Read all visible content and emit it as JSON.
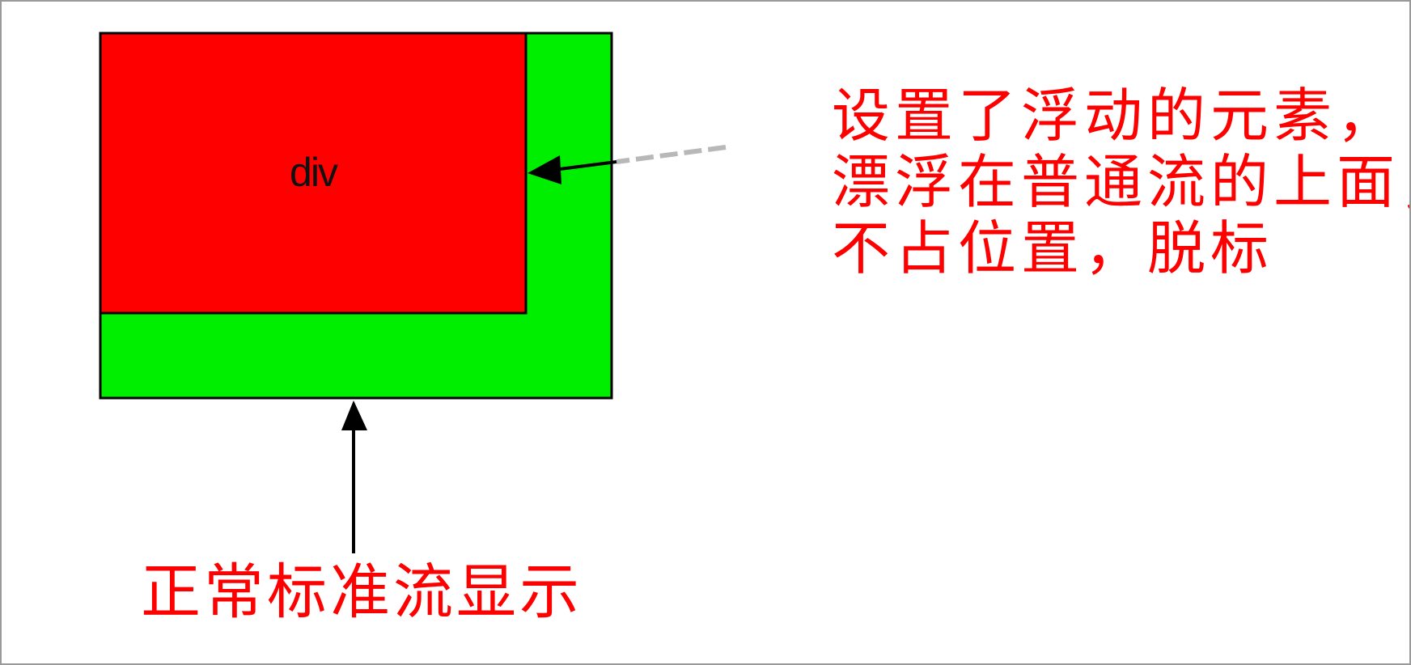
{
  "diagram": {
    "float_box_label": "div",
    "float_callout_lines": [
      "设置了浮动的元素，",
      "漂浮在普通流的上面，",
      "不占位置，脱标"
    ],
    "flow_callout": "正常标准流显示"
  },
  "colors": {
    "float_box_fill": "#ff0000",
    "flow_box_fill": "#00ee00",
    "border": "#000000",
    "callout_text": "#ff0000",
    "pointer_tail_dash": "#b8b8b8"
  }
}
